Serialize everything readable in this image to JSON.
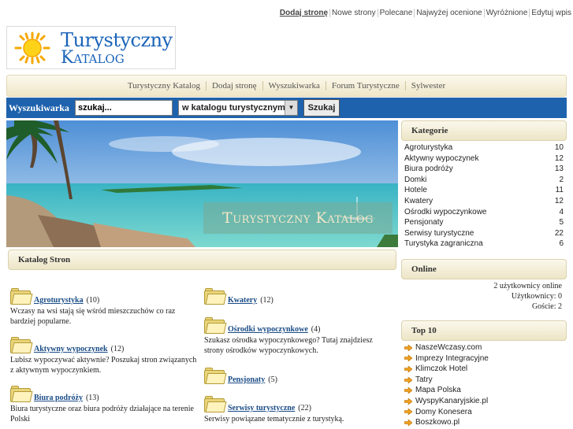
{
  "top_links": [
    "Dodaj stronę",
    "Nowe strony",
    "Polecane",
    "Najwyżej ocenione",
    "Wyróżnione",
    "Edytuj wpis"
  ],
  "logo": {
    "line1": "Turystyczny",
    "line2": "Katalog"
  },
  "nav": [
    "Turystyczny Katalog",
    "Dodaj stronę",
    "Wyszukiwarka",
    "Forum Turystyczne",
    "Sylwester"
  ],
  "search": {
    "label": "Wyszukiwarka",
    "value": "szukaj...",
    "select_value": "w katalogu turystycznym",
    "button": "Szukaj"
  },
  "banner": {
    "title": "Turystyczny Katalog"
  },
  "catalog": {
    "header": "Katalog Stron",
    "left": [
      {
        "name": "Agroturystyka",
        "count": "(10)",
        "desc": "Wczasy na wsi stają się wśród mieszczuchów co raz bardziej popularne."
      },
      {
        "name": "Aktywny wypoczynek",
        "count": "(12)",
        "desc": "Lubisz wypoczywać aktywnie? Poszukaj stron związanych z aktywnym wypoczynkiem."
      },
      {
        "name": "Biura podróży",
        "count": "(13)",
        "desc": "Biura turystyczne oraz biura podróży działające na terenie Polski"
      }
    ],
    "right": [
      {
        "name": "Kwatery",
        "count": "(12)",
        "desc": ""
      },
      {
        "name": "Ośrodki wypoczynkowe",
        "count": "(4)",
        "desc": "Szukasz ośrodka wypoczynkowego? Tutaj znajdziesz strony ośrodków wypoczynkowych."
      },
      {
        "name": "Pensjonaty",
        "count": "(5)",
        "desc": ""
      },
      {
        "name": "Serwisy turystyczne",
        "count": "(22)",
        "desc": "Serwisy powiązane tematycznie z turystyką."
      }
    ]
  },
  "sidebar": {
    "kategorie": {
      "title": "Kategorie",
      "items": [
        {
          "label": "Agroturystyka",
          "count": "10"
        },
        {
          "label": "Aktywny wypoczynek",
          "count": "12"
        },
        {
          "label": "Biura podróży",
          "count": "13"
        },
        {
          "label": "Domki",
          "count": "2"
        },
        {
          "label": "Hotele",
          "count": "11"
        },
        {
          "label": "Kwatery",
          "count": "12"
        },
        {
          "label": "Ośrodki wypoczynkowe",
          "count": "4"
        },
        {
          "label": "Pensjonaty",
          "count": "5"
        },
        {
          "label": "Serwisy turystyczne",
          "count": "22"
        },
        {
          "label": "Turystyka zagraniczna",
          "count": "6"
        }
      ]
    },
    "online": {
      "title": "Online",
      "users": "2 użytkownicy online",
      "registered": "Użytkownicy: 0",
      "guests": "Goście: 2"
    },
    "top10": {
      "title": "Top 10",
      "items": [
        "NaszeWczasy.com",
        "Imprezy Integracyjne",
        "Klimczok Hotel",
        "Tatry",
        "Mapa Polska",
        "WyspyKanaryjskie.pl",
        "Domy Konesera",
        "Boszkowo.pl"
      ]
    }
  }
}
